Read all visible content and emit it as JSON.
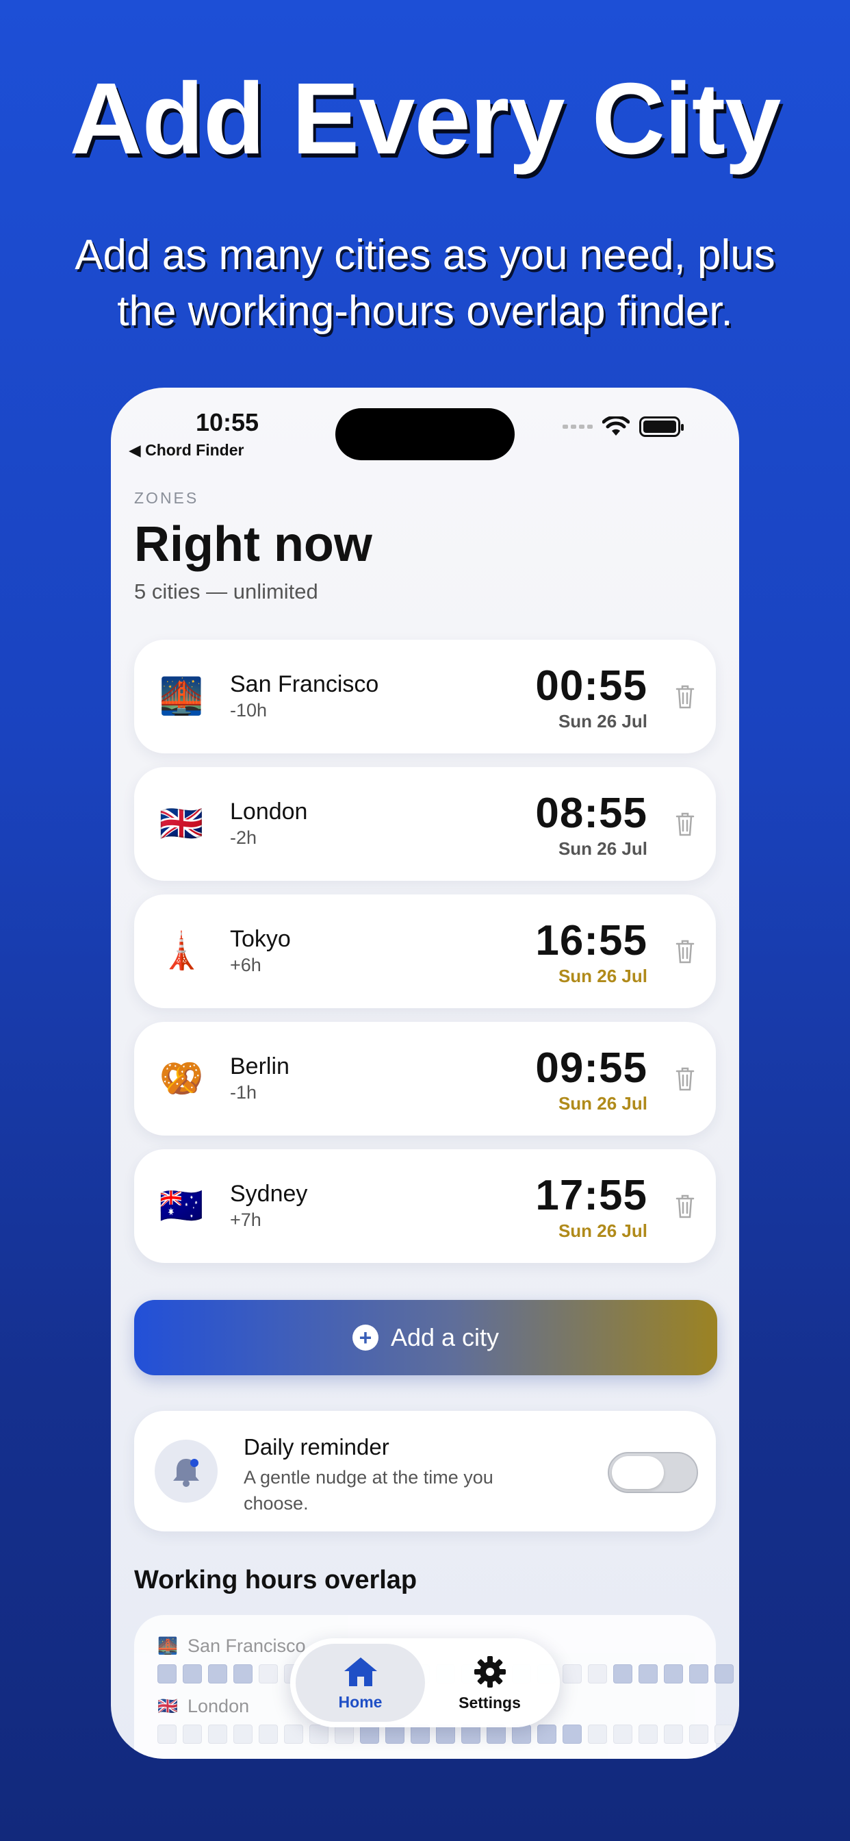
{
  "promo": {
    "headline": "Add Every City",
    "subhead": "Add as many cities as you need, plus the working-hours overlap finder."
  },
  "status": {
    "time": "10:55",
    "back_label": "◀ Chord Finder"
  },
  "header": {
    "section_label": "ZONES",
    "title": "Right now",
    "subtitle": "5 cities — unlimited"
  },
  "cities": [
    {
      "flag": "🌉",
      "name": "San Francisco",
      "offset": "-10h",
      "time": "00:55",
      "date": "Sun 26 Jul"
    },
    {
      "flag": "🇬🇧",
      "name": "London",
      "offset": "-2h",
      "time": "08:55",
      "date": "Sun 26 Jul"
    },
    {
      "flag": "🗼",
      "name": "Tokyo",
      "offset": "+6h",
      "time": "16:55",
      "date": "Sun 26 Jul"
    },
    {
      "flag": "🥨",
      "name": "Berlin",
      "offset": "-1h",
      "time": "09:55",
      "date": "Sun 26 Jul"
    },
    {
      "flag": "🇦🇺",
      "name": "Sydney",
      "offset": "+7h",
      "time": "17:55",
      "date": "Sun 26 Jul"
    }
  ],
  "add_button": {
    "label": "Add a city",
    "icon": "plus-circle-icon"
  },
  "reminder": {
    "title": "Daily reminder",
    "subtitle": "A gentle nudge at the time you choose.",
    "enabled": false
  },
  "overlap": {
    "title": "Working hours overlap",
    "rows": [
      {
        "flag": "🌉",
        "name": "San Francisco"
      },
      {
        "flag": "🇬🇧",
        "name": "London"
      }
    ]
  },
  "tabbar": {
    "home_label": "Home",
    "settings_label": "Settings"
  },
  "colors": {
    "accent": "#1f4fc6",
    "gold": "#b08a1a",
    "bg_top": "#1d4fd6",
    "bg_bottom": "#12297c"
  }
}
